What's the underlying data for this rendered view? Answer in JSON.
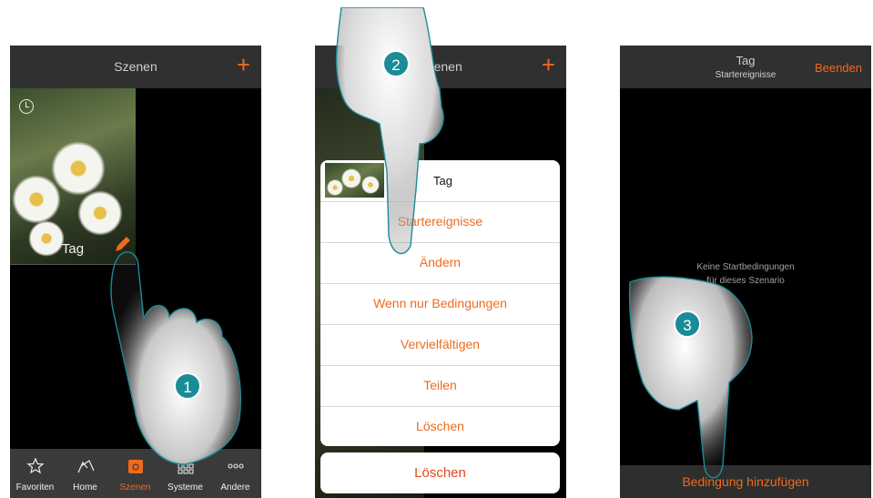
{
  "colors": {
    "accent": "#f06a1c",
    "bar": "#303030",
    "badge": "#1a8c98"
  },
  "screen1": {
    "header_title": "Szenen",
    "add_icon": "plus-icon",
    "tile_label": "Tag",
    "tabs": [
      {
        "label": "Favoriten",
        "icon": "star-icon"
      },
      {
        "label": "Home",
        "icon": "house-icon"
      },
      {
        "label": "Szenen",
        "icon": "scene-icon",
        "active": true
      },
      {
        "label": "Systeme",
        "icon": "grid-icon"
      },
      {
        "label": "Andere",
        "icon": "more-icon"
      }
    ],
    "step": "1"
  },
  "screen2": {
    "header_title": "Szenen",
    "sheet_title": "Tag",
    "options": [
      "Startereignisse",
      "Ändern",
      "Wenn nur Bedingungen",
      "Vervielfältigen",
      "Teilen",
      "Löschen"
    ],
    "cancel_label": "Löschen",
    "step": "2"
  },
  "screen3": {
    "header_title": "Tag",
    "header_subtitle": "Startereignisse",
    "finish_label": "Beenden",
    "empty_line1": "Keine Startbedingungen",
    "empty_line2": "für dieses Szenario",
    "add_button": "Bedingung hinzufügen",
    "step": "3"
  }
}
